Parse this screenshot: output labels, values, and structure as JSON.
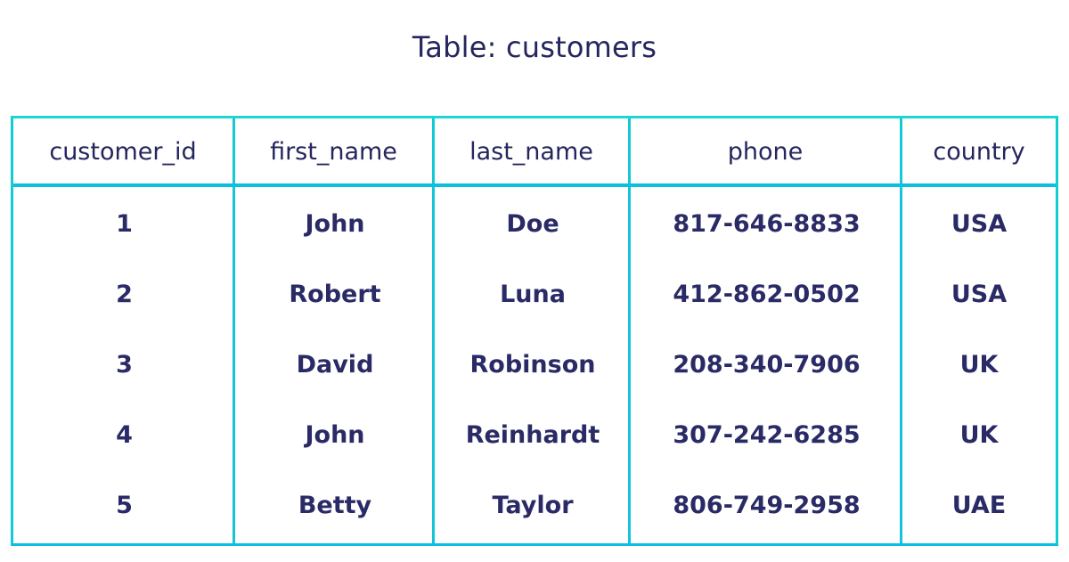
{
  "title": "Table: customers",
  "table": {
    "name": "customers",
    "columns": [
      "customer_id",
      "first_name",
      "last_name",
      "phone",
      "country"
    ],
    "rows": [
      [
        "1",
        "John",
        "Doe",
        "817-646-8833",
        "USA"
      ],
      [
        "2",
        "Robert",
        "Luna",
        "412-862-0502",
        "USA"
      ],
      [
        "3",
        "David",
        "Robinson",
        "208-340-7906",
        "UK"
      ],
      [
        "4",
        "John",
        "Reinhardt",
        "307-242-6285",
        "UK"
      ],
      [
        "5",
        "Betty",
        "Taylor",
        "806-749-2958",
        "UAE"
      ]
    ]
  },
  "colors": {
    "text": "#25265e",
    "border": "#14ccd0",
    "background": "#ffffff"
  }
}
